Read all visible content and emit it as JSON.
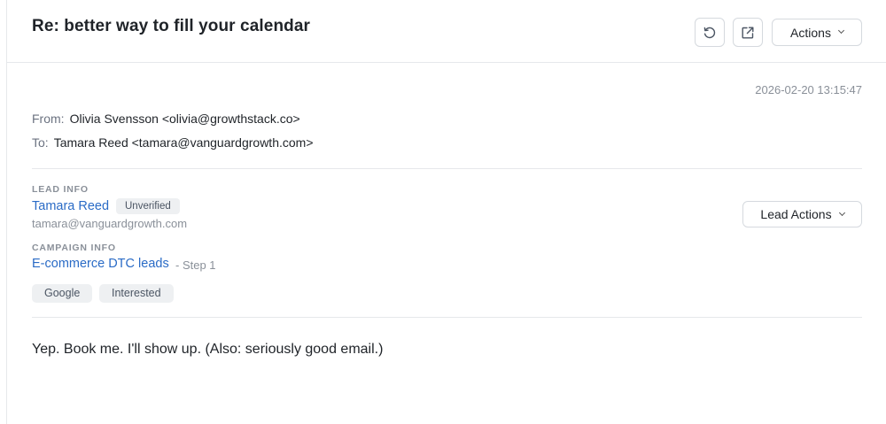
{
  "email": {
    "subject": "Re: better way to fill your calendar",
    "timestamp": "2026-02-20 13:15:47",
    "from_label": "From:",
    "from_value": "Olivia Svensson <olivia@growthstack.co>",
    "to_label": "To:",
    "to_value": "Tamara Reed <tamara@vanguardgrowth.com>",
    "body": "Yep. Book me. I'll show up. (Also: seriously good email.)"
  },
  "toolbar": {
    "refresh_icon": "refresh-icon",
    "open_external_icon": "external-link-icon",
    "actions_label": "Actions"
  },
  "lead": {
    "section_label": "LEAD INFO",
    "name": "Tamara Reed",
    "status_badge": "Unverified",
    "email": "tamara@vanguardgrowth.com",
    "actions_label": "Lead Actions"
  },
  "campaign": {
    "section_label": "CAMPAIGN INFO",
    "name": "E-commerce DTC leads",
    "step": "- Step 1"
  },
  "tags": [
    "Google",
    "Interested"
  ],
  "colors": {
    "link": "#2a6bc6",
    "muted": "#8a9099",
    "tag_bg": "#eef0f2"
  }
}
